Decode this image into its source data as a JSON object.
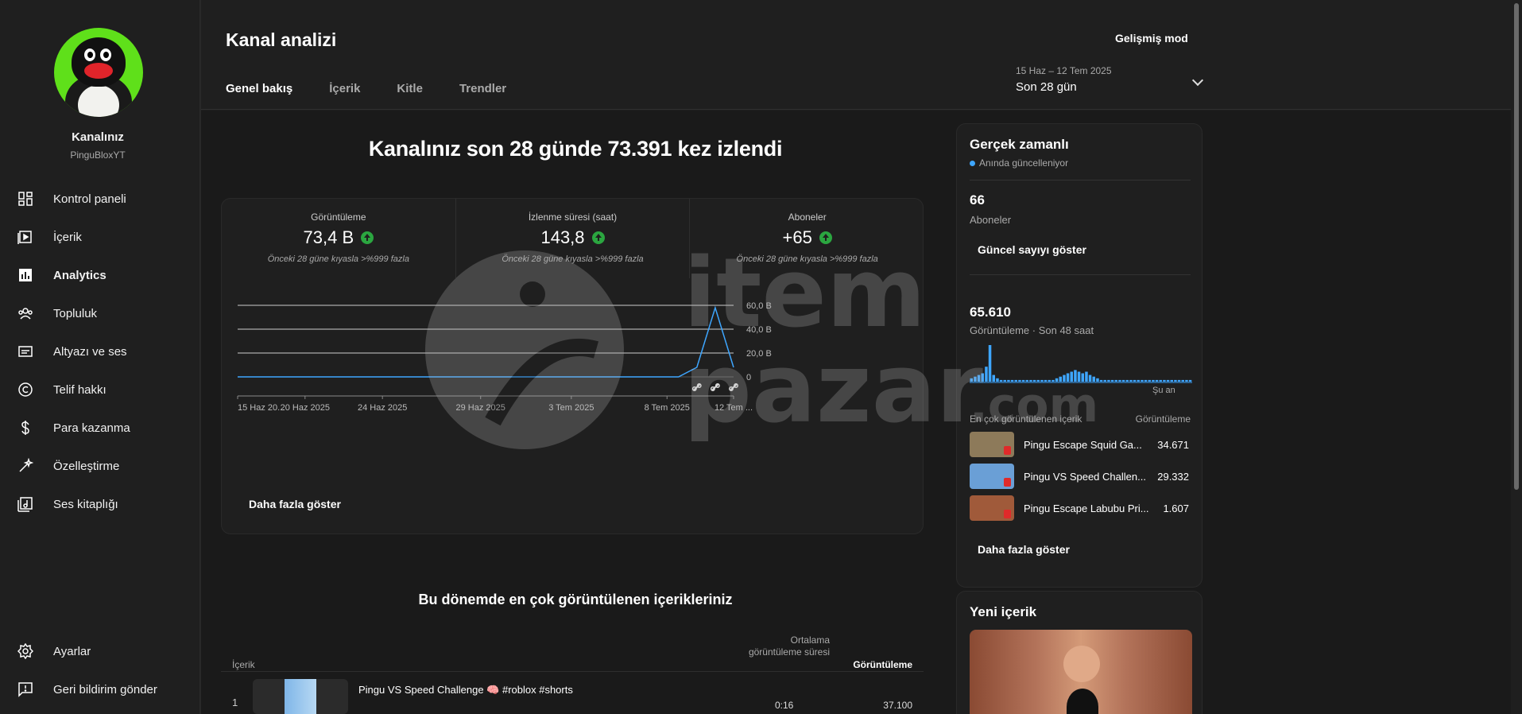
{
  "sidebar": {
    "channel_name": "Kanalınız",
    "channel_handle": "PinguBloxYT",
    "items": [
      {
        "label": "Kontrol paneli",
        "icon": "dashboard-icon"
      },
      {
        "label": "İçerik",
        "icon": "content-icon"
      },
      {
        "label": "Analytics",
        "icon": "analytics-icon",
        "active": true
      },
      {
        "label": "Topluluk",
        "icon": "community-icon"
      },
      {
        "label": "Altyazı ve ses",
        "icon": "subtitles-icon"
      },
      {
        "label": "Telif hakkı",
        "icon": "copyright-icon"
      },
      {
        "label": "Para kazanma",
        "icon": "dollar-icon"
      },
      {
        "label": "Özelleştirme",
        "icon": "magic-wand-icon"
      },
      {
        "label": "Ses kitaplığı",
        "icon": "audio-library-icon"
      }
    ],
    "bottom": [
      {
        "label": "Ayarlar",
        "icon": "gear-icon"
      },
      {
        "label": "Geri bildirim gönder",
        "icon": "feedback-icon"
      }
    ]
  },
  "header": {
    "title": "Kanal analizi",
    "advanced_mode": "Gelişmiş mod",
    "tabs": [
      "Genel bakış",
      "İçerik",
      "Kitle",
      "Trendler"
    ],
    "date_range_sub": "15 Haz – 12 Tem 2025",
    "date_range_label": "Son 28 gün"
  },
  "overview": {
    "headline": "Kanalınız son 28 günde 73.391 kez izlendi",
    "metrics": [
      {
        "label": "Görüntüleme",
        "value": "73,4 B",
        "note": "Önceki 28 güne kıyasla >%999 fazla"
      },
      {
        "label": "İzlenme süresi (saat)",
        "value": "143,8",
        "note": "Önceki 28 güne kıyasla >%999 fazla"
      },
      {
        "label": "Aboneler",
        "value": "+65",
        "note": "Önceki 28 güne kıyasla >%999 fazla"
      }
    ],
    "more_button": "Daha fazla göster"
  },
  "chart_data": {
    "type": "line",
    "x": [
      "15 Haz 20...",
      "20 Haz 2025",
      "24 Haz 2025",
      "29 Haz 2025",
      "3 Tem 2025",
      "8 Tem 2025",
      "12 Tem ..."
    ],
    "y_ticks": [
      "60,0 B",
      "40,0 B",
      "20,0 B",
      "0"
    ],
    "ylim": [
      0,
      60000
    ],
    "series": [
      {
        "color": "#3ea6ff",
        "values": [
          0,
          0,
          0,
          0,
          0,
          0,
          0,
          0,
          0,
          0,
          0,
          0,
          0,
          0,
          0,
          0,
          0,
          0,
          0,
          0,
          0,
          0,
          0,
          0,
          0,
          8000,
          58000,
          8000
        ]
      }
    ]
  },
  "top_content": {
    "title": "Bu dönemde en çok görüntülenen içerikleriniz",
    "col_content": "İçerik",
    "col_avg": "Ortalama görüntüleme süresi",
    "col_views": "Görüntüleme",
    "rows": [
      {
        "rank": "1",
        "title": "Pingu VS Speed Challenge 🧠 #roblox #shorts",
        "avg": "0:16",
        "views": "37.100"
      }
    ]
  },
  "realtime": {
    "title": "Gerçek zamanlı",
    "live": "Anında güncelleniyor",
    "subs_value": "66",
    "subs_label": "Aboneler",
    "show_count": "Güncel sayıyı göster",
    "views_value": "65.610",
    "views_label": "Görüntüleme · Son 48 saat",
    "now_label": "Şu an",
    "top_head_left": "En çok görüntülenen içerik",
    "top_head_right": "Görüntüleme",
    "spark": [
      2,
      3,
      4,
      5,
      9,
      22,
      4,
      2,
      1,
      1,
      1,
      1,
      1,
      1,
      1,
      1,
      1,
      1,
      1,
      1,
      1,
      1,
      1,
      2,
      3,
      4,
      5,
      6,
      7,
      6,
      5,
      6,
      4,
      3,
      2,
      1,
      1,
      1,
      1,
      1,
      1,
      1,
      1,
      1,
      1,
      1,
      1,
      1,
      1,
      1,
      1,
      1,
      1,
      1,
      1,
      1,
      1,
      1,
      1,
      1
    ],
    "top": [
      {
        "name": "Pingu Escape Squid Ga...",
        "value": "34.671",
        "color": "#8d7a5a"
      },
      {
        "name": "Pingu VS Speed Challen...",
        "value": "29.332",
        "color": "#6a9fd6"
      },
      {
        "name": "Pingu Escape Labubu Pri...",
        "value": "1.607",
        "color": "#a05a3a"
      }
    ],
    "more_button": "Daha fazla göster"
  },
  "new_content": {
    "title": "Yeni içerik"
  },
  "watermark": {
    "brand_line1": "item",
    "brand_line2": "pazar",
    "brand_suffix": ".com"
  }
}
